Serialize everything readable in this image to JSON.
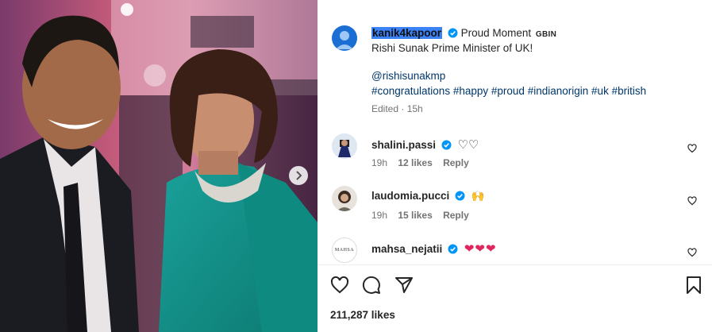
{
  "post": {
    "owner": "kanik4kapoor",
    "caption_title": "Proud Moment",
    "flag_tag": "GBIN",
    "caption_line": "Rishi Sunak Prime Minister of UK!",
    "mention": "@rishisunakmp",
    "hashtags": [
      "#congratulations",
      "#happy",
      "#proud",
      "#indianorigin",
      "#uk",
      "#british"
    ],
    "edited_time": "Edited · 15h",
    "likes": "211,287 likes"
  },
  "comments": [
    {
      "user": "shalini.passi",
      "text": "♡♡",
      "time": "19h",
      "likes": "12 likes",
      "reply": "Reply"
    },
    {
      "user": "laudomia.pucci",
      "text": "🙌",
      "time": "19h",
      "likes": "15 likes",
      "reply": "Reply"
    },
    {
      "user": "mahsa_nejatii",
      "text": "❤❤❤",
      "time": "",
      "likes": "",
      "reply": ""
    }
  ],
  "avatar_text": {
    "mahsa": "MAHSA"
  },
  "icons": {
    "like": "heart-outline-icon",
    "comment": "comment-bubble-icon",
    "share": "paper-plane-icon",
    "save": "bookmark-icon",
    "next": "chevron-right-icon",
    "verified": "verified-badge-icon"
  },
  "colors": {
    "verified": "#0095f6",
    "link": "#00376b",
    "meta": "#737373",
    "heart": "#ed4956"
  }
}
